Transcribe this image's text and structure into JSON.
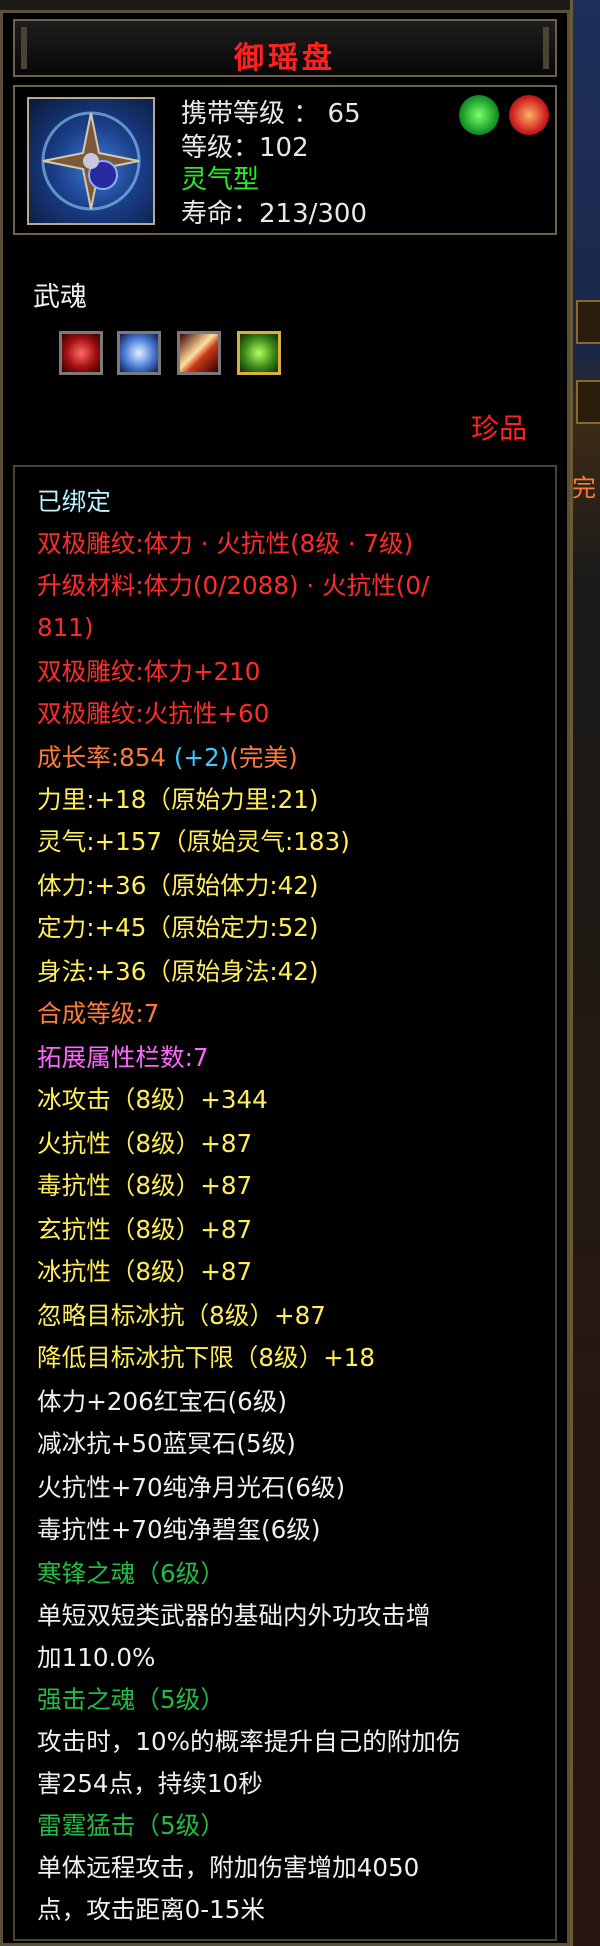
{
  "title": "御瑶盘",
  "header": {
    "carry_level": "携带等级 ： 65",
    "level": "等级：102",
    "type": "灵气型",
    "lifespan": "寿命：213/300"
  },
  "icons": {
    "item": "weapon-disc-icon",
    "badge_green": "green-emblem-icon",
    "badge_red": "red-emblem-icon",
    "slots": [
      "red-gem-slot-icon",
      "blue-crystal-slot-icon",
      "blade-slot-icon",
      "green-slot-icon"
    ]
  },
  "soul_label": "武魂",
  "quality": "珍品",
  "side_tag": "完",
  "stats": {
    "bound": "已绑定",
    "carve1": "双极雕纹:体力 · 火抗性(8级 · 7级)",
    "upgrade_a": "升级材料:体力(0/2088) · 火抗性(0/",
    "upgrade_b": "811)",
    "carve2": "双极雕纹:体力+210",
    "carve3": "双极雕纹:火抗性+60",
    "growth_a": "成长率:854 ",
    "growth_b": "(+2)",
    "growth_c": "(完美)",
    "attrs": [
      "力里:+18（原始力里:21)",
      "灵气:+157（原始灵气:183)",
      "体力:+36（原始体力:42)",
      "定力:+45（原始定力:52)",
      "身法:+36（原始身法:42)"
    ],
    "synth": "合成等级:7",
    "ext": "拓展属性栏数:7",
    "ext_attrs": [
      "冰攻击（8级）+344",
      "火抗性（8级）+87",
      "毒抗性（8级）+87",
      "玄抗性（8级）+87",
      "冰抗性（8级）+87",
      "忽略目标冰抗（8级）+87",
      "降低目标冰抗下限（8级）+18"
    ],
    "gems": [
      "体力+206红宝石(6级)",
      "减冰抗+50蓝冥石(5级)",
      "火抗性+70纯净月光石(6级)",
      "毒抗性+70纯净碧玺(6级)"
    ],
    "soul1_name": "寒锋之魂（6级）",
    "soul1_desc_a": "单短双短类武器的基础内外功攻击增",
    "soul1_desc_b": "加110.0%",
    "soul2_name": "强击之魂（5级）",
    "soul2_desc_a": "攻击时，10%的概率提升自己的附加伤",
    "soul2_desc_b": "害254点，持续10秒",
    "soul3_name": "雷霆猛击（5级）",
    "soul3_desc_a": "单体远程攻击，附加伤害增加4050",
    "soul3_desc_b": "点，攻击距离0-15米"
  }
}
